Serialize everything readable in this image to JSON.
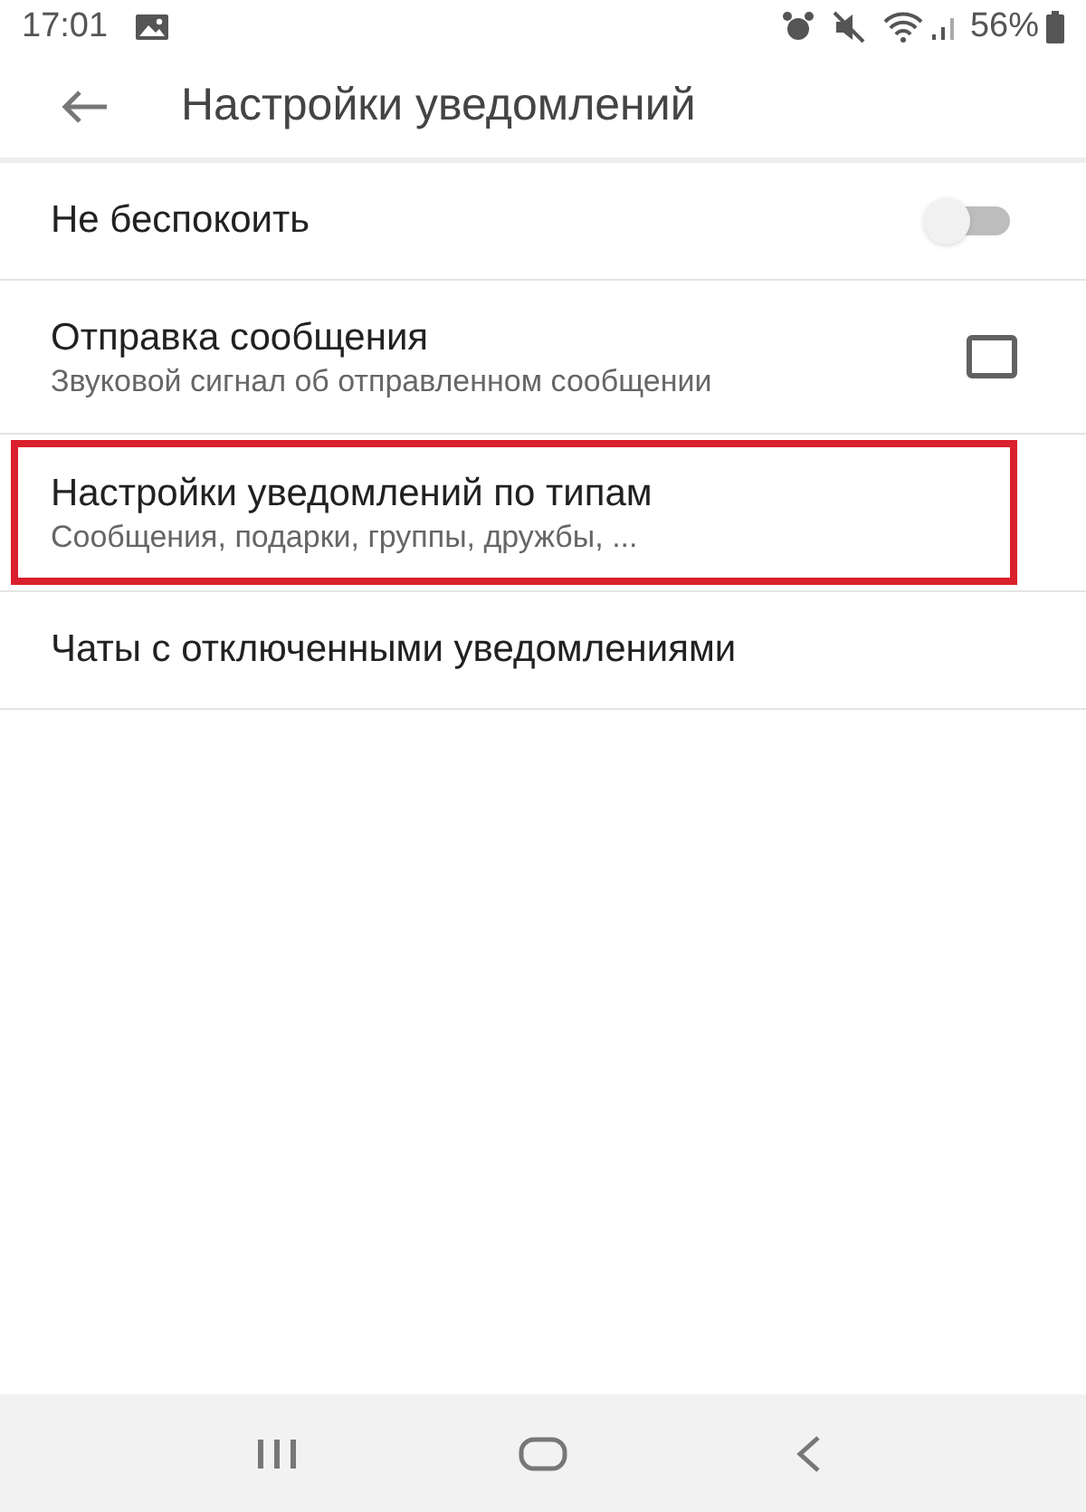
{
  "status_bar": {
    "time": "17:01",
    "battery": "56%"
  },
  "header": {
    "title": "Настройки уведомлений"
  },
  "items": [
    {
      "kind": "toggle",
      "title": "Не беспокоить",
      "on": false,
      "highlighted": false
    },
    {
      "kind": "checkbox",
      "title": "Отправка сообщения",
      "subtitle": "Звуковой сигнал об отправленном сообщении",
      "checked": false,
      "highlighted": false
    },
    {
      "kind": "plain",
      "title": "Настройки уведомлений по типам",
      "subtitle": "Сообщения, подарки, группы, дружбы, ...",
      "highlighted": true
    },
    {
      "kind": "plain",
      "title": "Чаты с отключенными уведомлениями",
      "highlighted": false
    }
  ]
}
